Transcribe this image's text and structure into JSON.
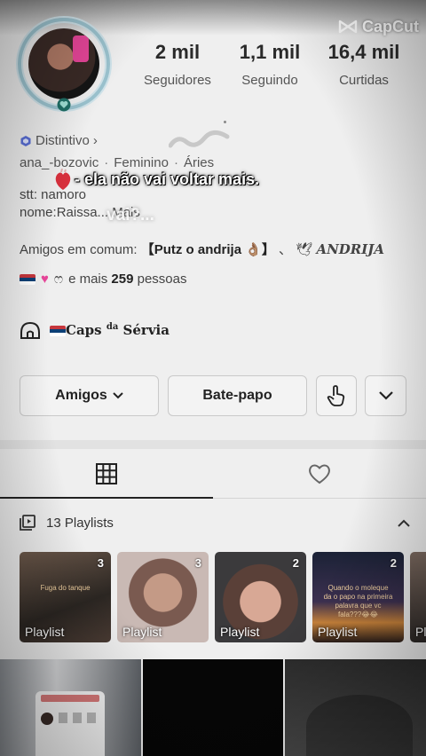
{
  "watermark": {
    "brand": "CapCut"
  },
  "profile": {
    "stats": [
      {
        "value": "2 mil",
        "label": "Seguidores"
      },
      {
        "value": "1,1 mil",
        "label": "Seguindo"
      },
      {
        "value": "16,4 mil",
        "label": "Curtidas"
      }
    ],
    "badge": "Distintivo",
    "badge_chevron": "›",
    "meta": {
      "username": "ana_-bozovic",
      "gender": "Feminino",
      "sign": "Áries",
      "separator": "·"
    },
    "bio_line1": "stt: namoro",
    "bio_line2": "nome:Raissa... Mais",
    "mutual_prefix": "Amigos em comum: ",
    "mutual_bold": "【Putz o andrija 👌🏽】",
    "mutual_sep": " 、",
    "mutual_second": "ANDRIJA",
    "more_prefix": "e mais ",
    "more_count": "259",
    "more_suffix": " pessoas",
    "community": "Caps",
    "community_sup": "da",
    "community_end": "Sérvia"
  },
  "overlay": {
    "caption": "- ela não vai voltar mais.",
    "ghost": "vai?..."
  },
  "actions": {
    "friends_label": "Amigos",
    "chat_label": "Bate-papo"
  },
  "tabs": [
    {
      "icon": "grid-icon",
      "active": true
    },
    {
      "icon": "heart-outline-icon",
      "active": false
    }
  ],
  "playlists": {
    "header": "13 Playlists",
    "items": [
      {
        "count": "3",
        "label": "Playlist",
        "caption": "Fuga do tanque"
      },
      {
        "count": "3",
        "label": "Playlist",
        "caption": ""
      },
      {
        "count": "2",
        "label": "Playlist",
        "caption": ""
      },
      {
        "count": "2",
        "label": "Playlist",
        "caption": "Quando o moleque da o papo na primeira palavra que vc fala???😂😂"
      },
      {
        "count": "",
        "label": "Pla",
        "caption": ""
      }
    ]
  },
  "colors": {
    "avatar_ring": "#9bc3cf",
    "badge_hex": "#5a6fd6",
    "phone_pink": "#e8469a"
  }
}
